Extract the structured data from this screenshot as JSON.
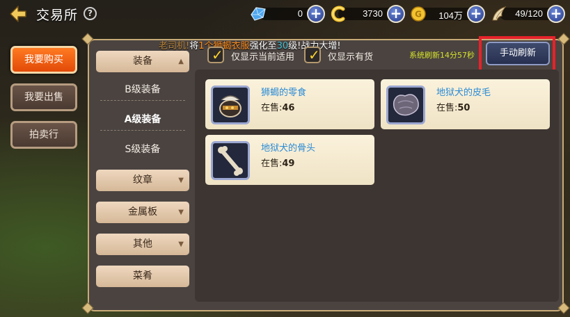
{
  "header": {
    "title": "交易所",
    "help_label": "?"
  },
  "resources": [
    {
      "name": "blue-crystal",
      "value": "0",
      "icon": "crystal-icon"
    },
    {
      "name": "gold-c-currency",
      "value": "3730",
      "icon": "c-coin-icon"
    },
    {
      "name": "gold-coin",
      "value": "104万",
      "icon": "coin-icon"
    },
    {
      "name": "wing-stamina",
      "value": "49/120",
      "icon": "wing-icon"
    }
  ],
  "left_menu": {
    "buy": "我要购买",
    "sell": "我要出售",
    "auction": "拍卖行"
  },
  "ticker": {
    "prefix": "老司机!",
    "part1": "将",
    "count": "1",
    "unit": "个",
    "item": "狮蝎衣服",
    "part2": "强化至",
    "level": "30",
    "part3": "级!战力大增!"
  },
  "categories": {
    "equipment": "装备",
    "sub": [
      "B级装备",
      "A级装备",
      "S级装备"
    ],
    "emblem": "纹章",
    "metal_plate": "金属板",
    "other": "其他",
    "dishes": "菜肴"
  },
  "filters": {
    "only_applicable": "仅显示当前适用",
    "only_in_stock": "仅显示有货"
  },
  "refresh": {
    "status": "系统刷新14分57秒",
    "button": "手动刷新"
  },
  "items": [
    {
      "name": "狮蝎的零食",
      "stock_label": "在售:",
      "stock": "46",
      "icon": "lion-scorpion-snack-icon"
    },
    {
      "name": "地狱犬的皮毛",
      "stock_label": "在售:",
      "stock": "50",
      "icon": "hellhound-fur-icon"
    },
    {
      "name": "地狱犬的骨头",
      "stock_label": "在售:",
      "stock": "49",
      "icon": "hellhound-bone-icon"
    }
  ],
  "colors": {
    "active_tab": "#e24a07",
    "item_name": "#2a8bd6",
    "refresh_status": "#d6e22a",
    "highlight": "#e8222a"
  }
}
